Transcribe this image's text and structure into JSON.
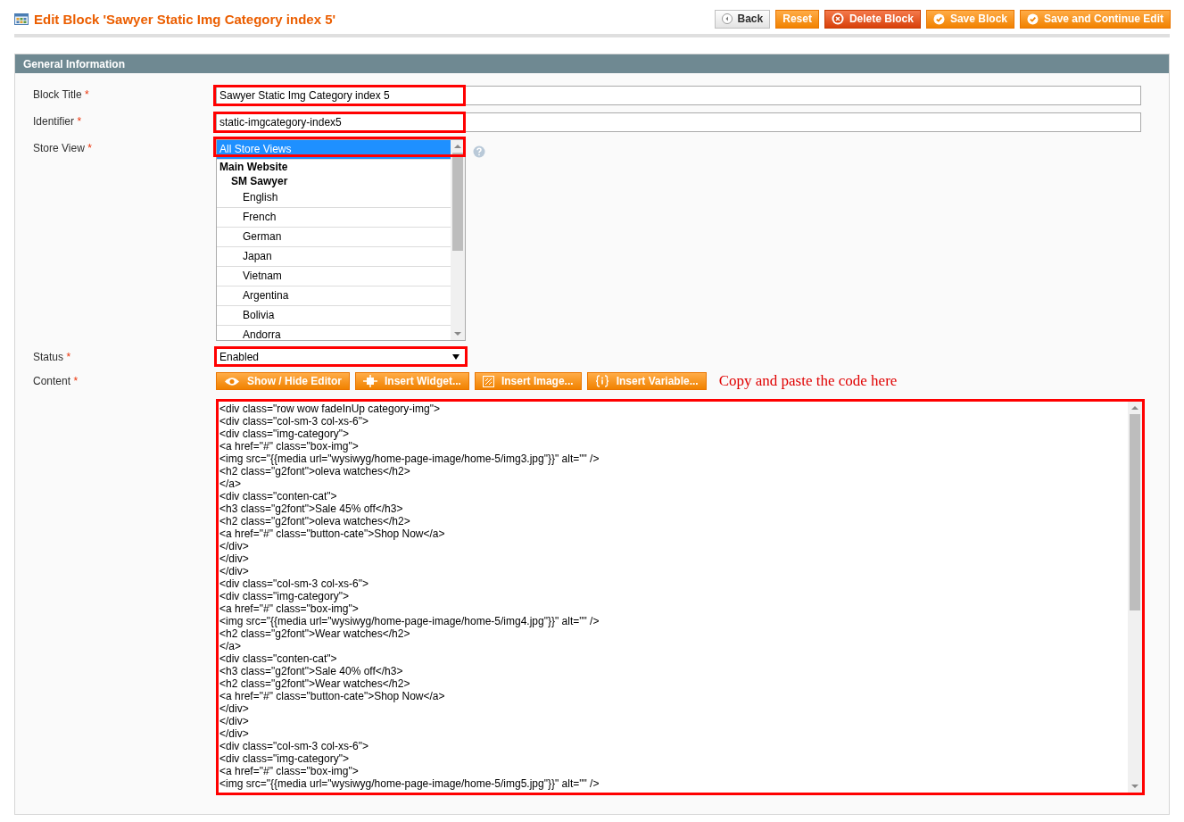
{
  "page": {
    "title": "Edit Block 'Sawyer Static Img Category index 5'"
  },
  "actions": [
    {
      "label": "Back",
      "kind": "back"
    },
    {
      "label": "Reset",
      "kind": "plain"
    },
    {
      "label": "Delete Block",
      "kind": "delete"
    },
    {
      "label": "Save Block",
      "kind": "save"
    },
    {
      "label": "Save and Continue Edit",
      "kind": "save"
    }
  ],
  "section": {
    "title": "General Information"
  },
  "fields": [
    {
      "kind": "text",
      "label": "Block Title",
      "required_mark": "*",
      "value": "Sawyer Static Img Category index 5",
      "highlighted": true
    },
    {
      "kind": "text",
      "label": "Identifier",
      "required_mark": "*",
      "value": "static-imgcategory-index5",
      "highlighted": true
    },
    {
      "kind": "multiselect",
      "label": "Store View",
      "required_mark": "*",
      "highlighted": true,
      "options": [
        {
          "label": "All Store Views",
          "selected": true
        },
        {
          "label": "Main Website",
          "kind": "group",
          "children": [
            {
              "label": "SM Sawyer",
              "kind": "group",
              "children": [
                {
                  "label": "English",
                  "selected": false
                },
                {
                  "label": "French",
                  "selected": false
                },
                {
                  "label": "German",
                  "selected": false
                },
                {
                  "label": "Japan",
                  "selected": false
                },
                {
                  "label": "Vietnam",
                  "selected": false
                },
                {
                  "label": "Argentina",
                  "selected": false
                },
                {
                  "label": "Bolivia",
                  "selected": false
                },
                {
                  "label": "Andorra",
                  "selected": false
                }
              ]
            }
          ]
        }
      ]
    },
    {
      "kind": "select",
      "label": "Status",
      "required_mark": "*",
      "value": "Enabled",
      "highlighted": true
    },
    {
      "kind": "editor",
      "label": "Content",
      "required_mark": "*",
      "highlighted": true,
      "note": "Copy and paste the code here",
      "toolbar": [
        {
          "label": "Show / Hide Editor",
          "kind": "eye"
        },
        {
          "label": "Insert Widget...",
          "kind": "widget"
        },
        {
          "label": "Insert Image...",
          "kind": "image"
        },
        {
          "label": "Insert Variable...",
          "kind": "variable"
        }
      ],
      "lines": [
        "<div class=\"row wow fadeInUp category-img\">",
        "<div class=\"col-sm-3 col-xs-6\">",
        "<div class=\"img-category\">",
        "<a href=\"#\" class=\"box-img\">",
        "<img src=\"{{media url=\"wysiwyg/home-page-image/home-5/img3.jpg\"}}\" alt=\"\" />",
        "<h2 class=\"g2font\">oleva watches</h2>",
        "</a>",
        "<div class=\"conten-cat\">",
        "<h3 class=\"g2font\">Sale 45% off</h3>",
        "<h2 class=\"g2font\">oleva watches</h2>",
        "<a href=\"#\" class=\"button-cate\">Shop Now</a>",
        "</div>",
        "</div>",
        "</div>",
        "<div class=\"col-sm-3 col-xs-6\">",
        "<div class=\"img-category\">",
        "<a href=\"#\" class=\"box-img\">",
        "<img src=\"{{media url=\"wysiwyg/home-page-image/home-5/img4.jpg\"}}\" alt=\"\" />",
        "<h2 class=\"g2font\">Wear watches</h2>",
        "</a>",
        "<div class=\"conten-cat\">",
        "<h3 class=\"g2font\">Sale 40% off</h3>",
        "<h2 class=\"g2font\">Wear watches</h2>",
        "<a href=\"#\" class=\"button-cate\">Shop Now</a>",
        "</div>",
        "</div>",
        "</div>",
        "<div class=\"col-sm-3 col-xs-6\">",
        "<div class=\"img-category\">",
        "<a href=\"#\" class=\"box-img\">",
        "<img src=\"{{media url=\"wysiwyg/home-page-image/home-5/img5.jpg\"}}\" alt=\"\" />"
      ]
    }
  ]
}
